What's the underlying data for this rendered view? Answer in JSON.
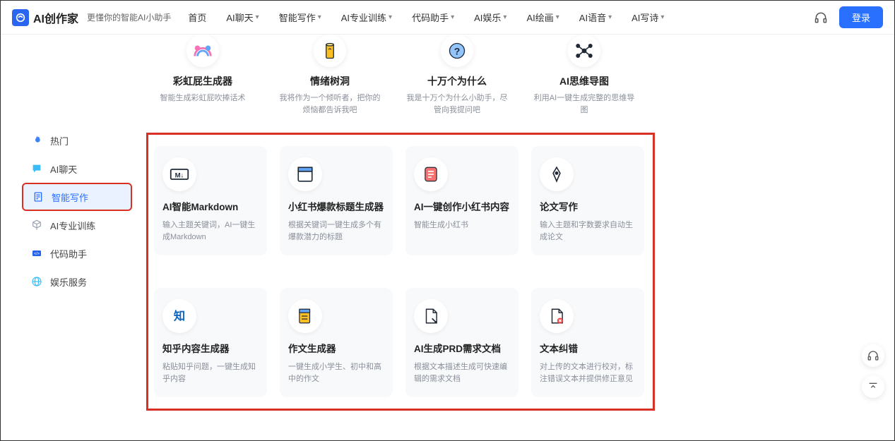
{
  "header": {
    "logo": "AI创作家",
    "tagline": "更懂你的智能AI小助手",
    "nav": [
      {
        "label": "首页",
        "dropdown": false
      },
      {
        "label": "AI聊天",
        "dropdown": true
      },
      {
        "label": "智能写作",
        "dropdown": true
      },
      {
        "label": "AI专业训练",
        "dropdown": true
      },
      {
        "label": "代码助手",
        "dropdown": true
      },
      {
        "label": "AI娱乐",
        "dropdown": true
      },
      {
        "label": "AI绘画",
        "dropdown": true
      },
      {
        "label": "AI语音",
        "dropdown": true
      },
      {
        "label": "AI写诗",
        "dropdown": true
      }
    ],
    "login": "登录"
  },
  "sidebar": {
    "items": [
      {
        "label": "热门",
        "icon": "fire-icon",
        "color": "#3b82f6"
      },
      {
        "label": "AI聊天",
        "icon": "chat-icon",
        "color": "#38bdf8"
      },
      {
        "label": "智能写作",
        "icon": "doc-icon",
        "color": "#2970ff",
        "active": true
      },
      {
        "label": "AI专业训练",
        "icon": "cube-icon",
        "color": "#9ca3af"
      },
      {
        "label": "代码助手",
        "icon": "code-icon",
        "color": "#2563eb"
      },
      {
        "label": "娱乐服务",
        "icon": "globe-icon",
        "color": "#38bdf8"
      }
    ]
  },
  "top_cards": [
    {
      "title": "彩虹屁生成器",
      "desc": "智能生成彩虹屁吹捧话术"
    },
    {
      "title": "情绪树洞",
      "desc": "我将作为一个倾听者，把你的烦恼都告诉我吧"
    },
    {
      "title": "十万个为什么",
      "desc": "我是十万个为什么小助手，尽管向我提问吧"
    },
    {
      "title": "AI思维导图",
      "desc": "利用AI一键生成完整的思维导图"
    }
  ],
  "grid_cards": [
    {
      "title": "AI智能Markdown",
      "desc": "输入主题关键词，AI一键生成Markdown"
    },
    {
      "title": "小红书爆款标题生成器",
      "desc": "根据关键词一键生成多个有爆款潜力的标题"
    },
    {
      "title": "AI一键创作小红书内容",
      "desc": "智能生成小红书"
    },
    {
      "title": "论文写作",
      "desc": "输入主题和字数要求自动生成论文"
    },
    {
      "title": "知乎内容生成器",
      "desc": "粘贴知乎问题，一键生成知乎内容"
    },
    {
      "title": "作文生成器",
      "desc": "一键生成小学生、初中和高中的作文"
    },
    {
      "title": "AI生成PRD需求文档",
      "desc": "根据文本描述生成可快速编辑的需求文档"
    },
    {
      "title": "文本纠错",
      "desc": "对上传的文本进行校对，标注错误文本并提供修正意见"
    }
  ]
}
